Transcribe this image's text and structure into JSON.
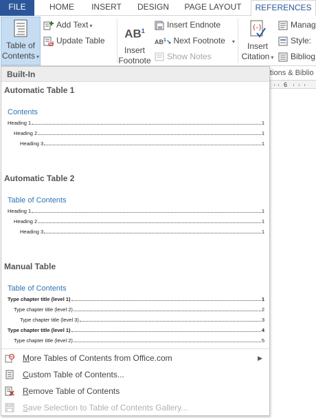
{
  "tabs": [
    {
      "label": "FILE"
    },
    {
      "label": "HOME"
    },
    {
      "label": "INSERT"
    },
    {
      "label": "DESIGN"
    },
    {
      "label": "PAGE LAYOUT"
    },
    {
      "label": "REFERENCES"
    }
  ],
  "ribbon": {
    "toc_line1": "Table of",
    "toc_line2": "Contents",
    "add_text": "Add Text",
    "update_table": "Update Table",
    "insert_footnote_line1": "Insert",
    "insert_footnote_line2": "Footnote",
    "insert_endnote": "Insert Endnote",
    "next_footnote": "Next Footnote",
    "show_notes": "Show Notes",
    "insert_citation_line1": "Insert",
    "insert_citation_line2": "Citation",
    "manage": "Manag",
    "style": "Style:",
    "bibliography": "Bibliog",
    "group_label": "tions & Biblio",
    "ruler_number": "6"
  },
  "gallery": {
    "section_header": "Built-In",
    "items": [
      {
        "title": "Automatic Table 1",
        "heading": "Contents",
        "lines": [
          {
            "text": "Heading 1",
            "page": "1"
          },
          {
            "text": "Heading 2",
            "page": "1"
          },
          {
            "text": "Heading 3",
            "page": "1"
          }
        ]
      },
      {
        "title": "Automatic Table 2",
        "heading": "Table of Contents",
        "lines": [
          {
            "text": "Heading 1",
            "page": "1"
          },
          {
            "text": "Heading 2",
            "page": "1"
          },
          {
            "text": "Heading 3",
            "page": "1"
          }
        ]
      },
      {
        "title": "Manual Table",
        "heading": "Table of Contents",
        "lines": [
          {
            "text": "Type chapter title (level 1)",
            "page": "1"
          },
          {
            "text": "Type chapter title (level 2)",
            "page": "2"
          },
          {
            "text": "Type chapter title (level 3)",
            "page": "3"
          },
          {
            "text": "Type chapter title (level 1)",
            "page": "4"
          },
          {
            "text": "Type chapter title (level 2)",
            "page": "5"
          }
        ]
      }
    ]
  },
  "menu": {
    "more_tables": {
      "accel": "M",
      "rest": "ore Tables of Contents from Office.com"
    },
    "custom_table": {
      "accel": "C",
      "rest": "ustom Table of Contents..."
    },
    "remove_table": {
      "accel": "R",
      "rest": "emove Table of Contents"
    },
    "save_selection": {
      "accel": "S",
      "rest": "ave Selection to Table of Contents Gallery..."
    }
  },
  "colors": {
    "file_tab": "#2b579a",
    "selected_button": "#c5dcf2",
    "toc_heading": "#2e74b5"
  }
}
